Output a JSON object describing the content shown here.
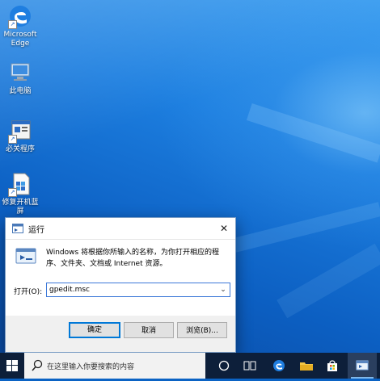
{
  "desktop": {
    "icons": [
      {
        "label": "Microsoft Edge",
        "icon": "edge-icon"
      },
      {
        "label": "此电脑",
        "icon": "computer-icon"
      },
      {
        "label": "必关程序",
        "icon": "program-icon"
      },
      {
        "label": "修复开机蓝屏",
        "icon": "repair-icon"
      }
    ]
  },
  "run_dialog": {
    "title": "运行",
    "close_glyph": "✕",
    "description": "Windows 将根据你所输入的名称，为你打开相应的程序、文件夹、文档或 Internet 资源。",
    "open_label": "打开(O):",
    "input_value": "gpedit.msc",
    "dropdown_glyph": "⌄",
    "buttons": {
      "ok": "确定",
      "cancel": "取消",
      "browse": "浏览(B)..."
    }
  },
  "taskbar": {
    "search_placeholder": "在这里输入你要搜索的内容",
    "apps": [
      "start-icon",
      "task-view-icon",
      "edge-icon",
      "file-explorer-icon",
      "store-icon",
      "run-icon"
    ]
  },
  "colors": {
    "accent": "#0078d7",
    "taskbar": "#0d1f3a"
  }
}
